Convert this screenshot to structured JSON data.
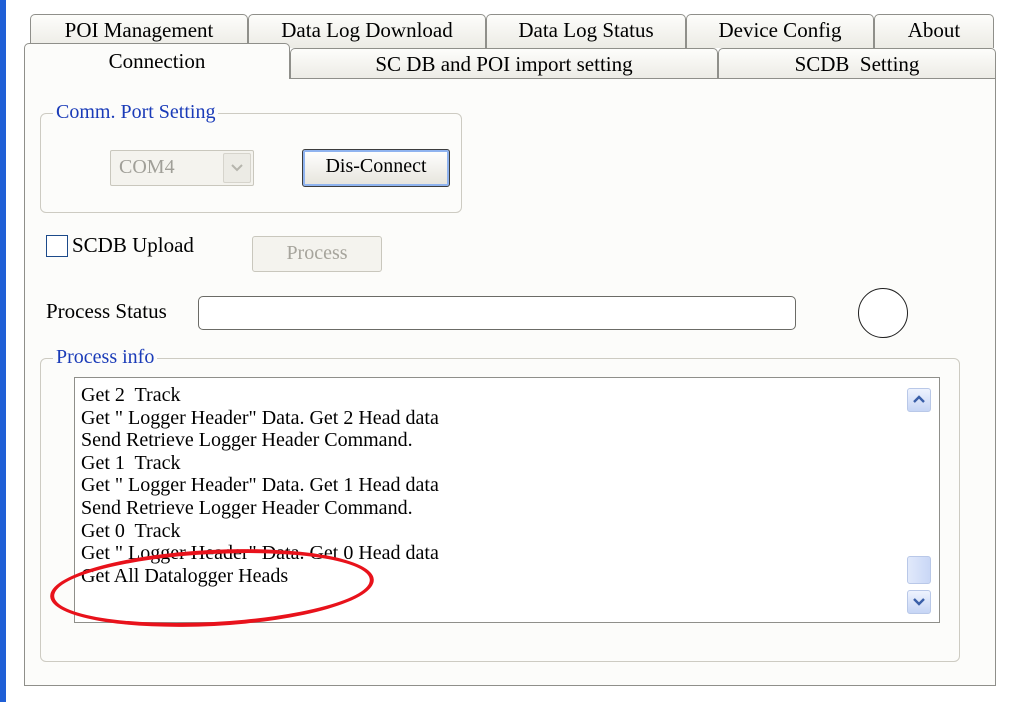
{
  "tabs_back": [
    {
      "label": "POI Management"
    },
    {
      "label": "Data Log Download"
    },
    {
      "label": "Data Log Status"
    },
    {
      "label": "Device Config"
    },
    {
      "label": "About"
    }
  ],
  "tabs_front": [
    {
      "label": "Connection",
      "active": true
    },
    {
      "label": "SC DB and POI import setting",
      "active": false
    },
    {
      "label": "SCDB  Setting",
      "active": false
    }
  ],
  "comm_port": {
    "legend": "Comm. Port Setting",
    "port_value": "COM4",
    "disconnect_label": "Dis-Connect"
  },
  "scdb": {
    "upload_label": "SCDB Upload",
    "upload_checked": false,
    "process_label": "Process"
  },
  "process_status": {
    "label": "Process Status",
    "value": ""
  },
  "process_info": {
    "legend": "Process info",
    "lines": [
      "Get 2  Track",
      "Get \" Logger Header\" Data. Get 2 Head data",
      "Send Retrieve Logger Header Command.",
      "Get 1  Track",
      "Get \" Logger Header\" Data. Get 1 Head data",
      "Send Retrieve Logger Header Command.",
      "Get 0  Track",
      "Get \" Logger Header\" Data. Get 0 Head data",
      "Get All Datalogger Heads"
    ]
  },
  "icons": {
    "combo_arrow": "chevron-down-icon",
    "scroll_up": "scroll-up-icon",
    "scroll_down": "scroll-down-icon",
    "status_indicator": "status-circle-icon"
  },
  "colors": {
    "legend_text": "#1a3bb8",
    "annotation": "#e8121b",
    "window_edge": "#1f5fd6"
  }
}
